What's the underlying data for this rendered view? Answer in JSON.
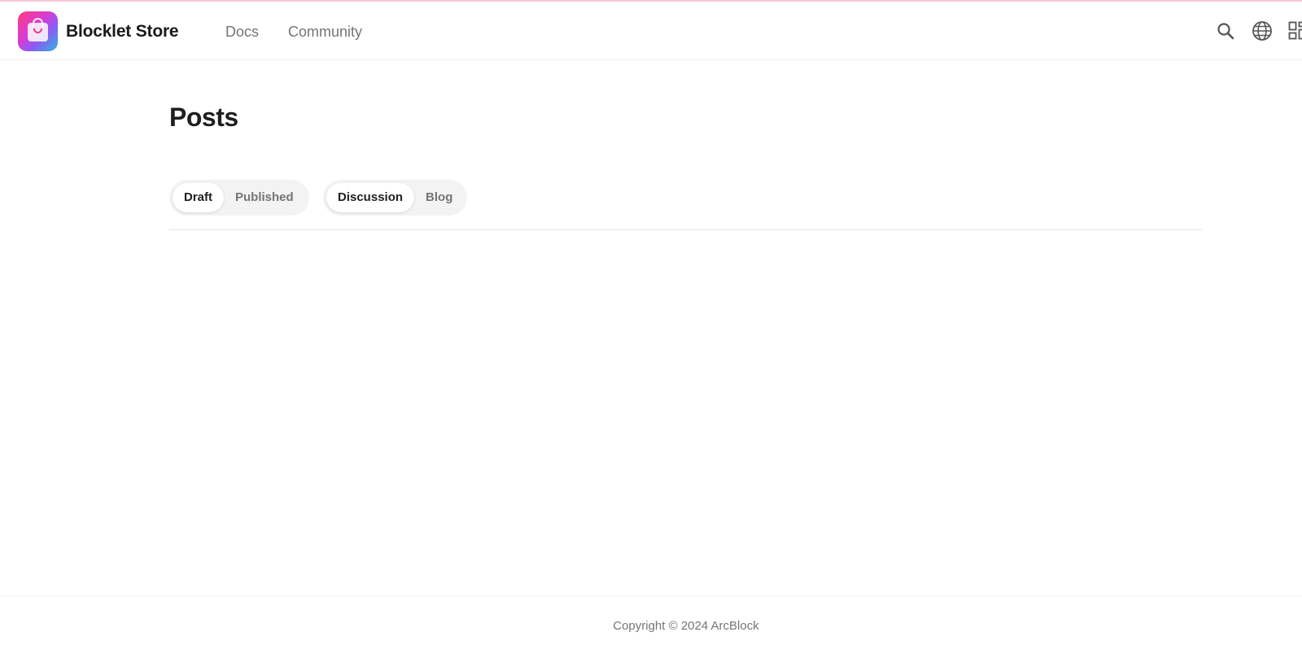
{
  "header": {
    "brand": "Blocklet Store",
    "nav": [
      "Docs",
      "Community"
    ],
    "icons": [
      "search-icon",
      "globe-icon",
      "apps-icon"
    ]
  },
  "main": {
    "title": "Posts",
    "status_tabs": [
      {
        "label": "Draft",
        "active": true
      },
      {
        "label": "Published",
        "active": false
      }
    ],
    "type_tabs": [
      {
        "label": "Discussion",
        "active": true
      },
      {
        "label": "Blog",
        "active": false
      }
    ]
  },
  "footer": {
    "copyright": "Copyright © 2024 ArcBlock"
  },
  "colors": {
    "accent_pink": "#ff3d7f",
    "muted_text": "#757575",
    "title_text": "#1f1f1f"
  }
}
